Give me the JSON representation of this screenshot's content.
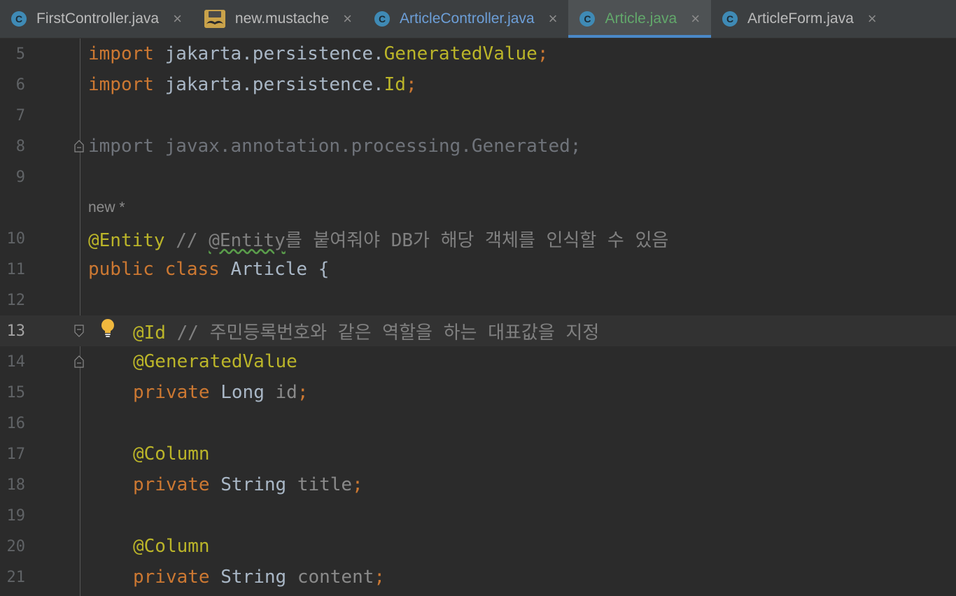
{
  "tabs": [
    {
      "label": "FirstController.java",
      "icon": "class-icon",
      "icon_text": "C",
      "state": "normal"
    },
    {
      "label": "new.mustache",
      "icon": "mustache-icon",
      "icon_text": "",
      "state": "normal"
    },
    {
      "label": "ArticleController.java",
      "icon": "class-icon",
      "icon_text": "C",
      "state": "modified"
    },
    {
      "label": "Article.java",
      "icon": "class-icon",
      "icon_text": "C",
      "state": "active"
    },
    {
      "label": "ArticleForm.java",
      "icon": "class-icon",
      "icon_text": "C",
      "state": "normal"
    }
  ],
  "close_glyph": "×",
  "editor": {
    "lines": [
      {
        "num": "5",
        "tokens": [
          [
            "kw",
            "import "
          ],
          [
            "",
            "jakarta.persistence."
          ],
          [
            "ann",
            "GeneratedValue"
          ],
          [
            "semi",
            ";"
          ]
        ]
      },
      {
        "num": "6",
        "tokens": [
          [
            "kw",
            "import "
          ],
          [
            "",
            "jakarta.persistence."
          ],
          [
            "ann",
            "Id"
          ],
          [
            "semi",
            ";"
          ]
        ]
      },
      {
        "num": "7",
        "tokens": []
      },
      {
        "num": "8",
        "tokens": [
          [
            "unused",
            "import javax.annotation.processing.Generated;"
          ]
        ]
      },
      {
        "num": "9",
        "tokens": []
      },
      {
        "num": "",
        "inlay": "new *"
      },
      {
        "num": "10",
        "tokens": [
          [
            "ann",
            "@Entity"
          ],
          [
            "cmt",
            " // "
          ],
          [
            "cmt squig",
            "@Entity"
          ],
          [
            "cmt",
            "를 붙여줘야 DB가 해당 객체를 인식할 수 있음"
          ]
        ]
      },
      {
        "num": "11",
        "tokens": [
          [
            "kw",
            "public class "
          ],
          [
            "",
            "Article {"
          ]
        ]
      },
      {
        "num": "12",
        "tokens": []
      },
      {
        "num": "13",
        "indent": true,
        "current": true,
        "tokens": [
          [
            "ann",
            "@Id"
          ],
          [
            "cmt",
            " // 주민등록번호와 같은 역할을 하는 대표값을 지정"
          ]
        ]
      },
      {
        "num": "14",
        "indent": true,
        "tokens": [
          [
            "ann",
            "@GeneratedValue"
          ]
        ]
      },
      {
        "num": "15",
        "indent": true,
        "tokens": [
          [
            "kw",
            "private "
          ],
          [
            "",
            "Long "
          ],
          [
            "fldgray",
            "id"
          ],
          [
            "semi",
            ";"
          ]
        ]
      },
      {
        "num": "16",
        "tokens": []
      },
      {
        "num": "17",
        "indent": true,
        "tokens": [
          [
            "ann",
            "@Column"
          ]
        ]
      },
      {
        "num": "18",
        "indent": true,
        "tokens": [
          [
            "kw",
            "private "
          ],
          [
            "",
            "String "
          ],
          [
            "fldgray",
            "title"
          ],
          [
            "semi",
            ";"
          ]
        ]
      },
      {
        "num": "19",
        "tokens": []
      },
      {
        "num": "20",
        "indent": true,
        "tokens": [
          [
            "ann",
            "@Column"
          ]
        ]
      },
      {
        "num": "21",
        "indent": true,
        "tokens": [
          [
            "kw",
            "private "
          ],
          [
            "",
            "String "
          ],
          [
            "fldgray",
            "content"
          ],
          [
            "semi",
            ";"
          ]
        ]
      }
    ]
  }
}
